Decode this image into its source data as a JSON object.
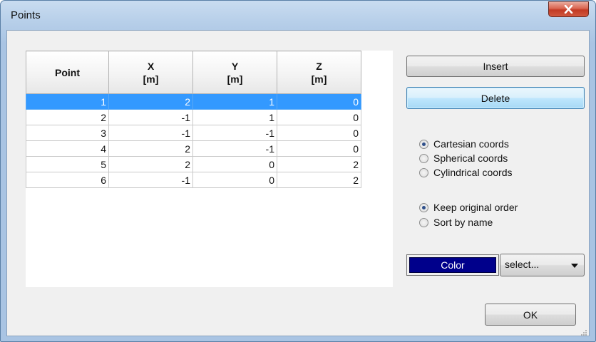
{
  "window": {
    "title": "Points"
  },
  "table": {
    "headers": [
      {
        "line1": "Point",
        "line2": ""
      },
      {
        "line1": "X",
        "line2": "[m]"
      },
      {
        "line1": "Y",
        "line2": "[m]"
      },
      {
        "line1": "Z",
        "line2": "[m]"
      }
    ],
    "rows": [
      [
        "1",
        "2",
        "1",
        "0"
      ],
      [
        "2",
        "-1",
        "1",
        "0"
      ],
      [
        "3",
        "-1",
        "-1",
        "0"
      ],
      [
        "4",
        "2",
        "-1",
        "0"
      ],
      [
        "5",
        "2",
        "0",
        "2"
      ],
      [
        "6",
        "-1",
        "0",
        "2"
      ]
    ],
    "selected_row": 1
  },
  "buttons": {
    "insert": "Insert",
    "delete": "Delete",
    "ok": "OK"
  },
  "coords": {
    "options": [
      "Cartesian coords",
      "Spherical coords",
      "Cylindrical coords"
    ],
    "selected": "Cartesian coords"
  },
  "order": {
    "options": [
      "Keep original order",
      "Sort by name"
    ],
    "selected": "Keep original order"
  },
  "color": {
    "label": "Color",
    "value": "#00008b"
  },
  "select": {
    "value": "select..."
  }
}
